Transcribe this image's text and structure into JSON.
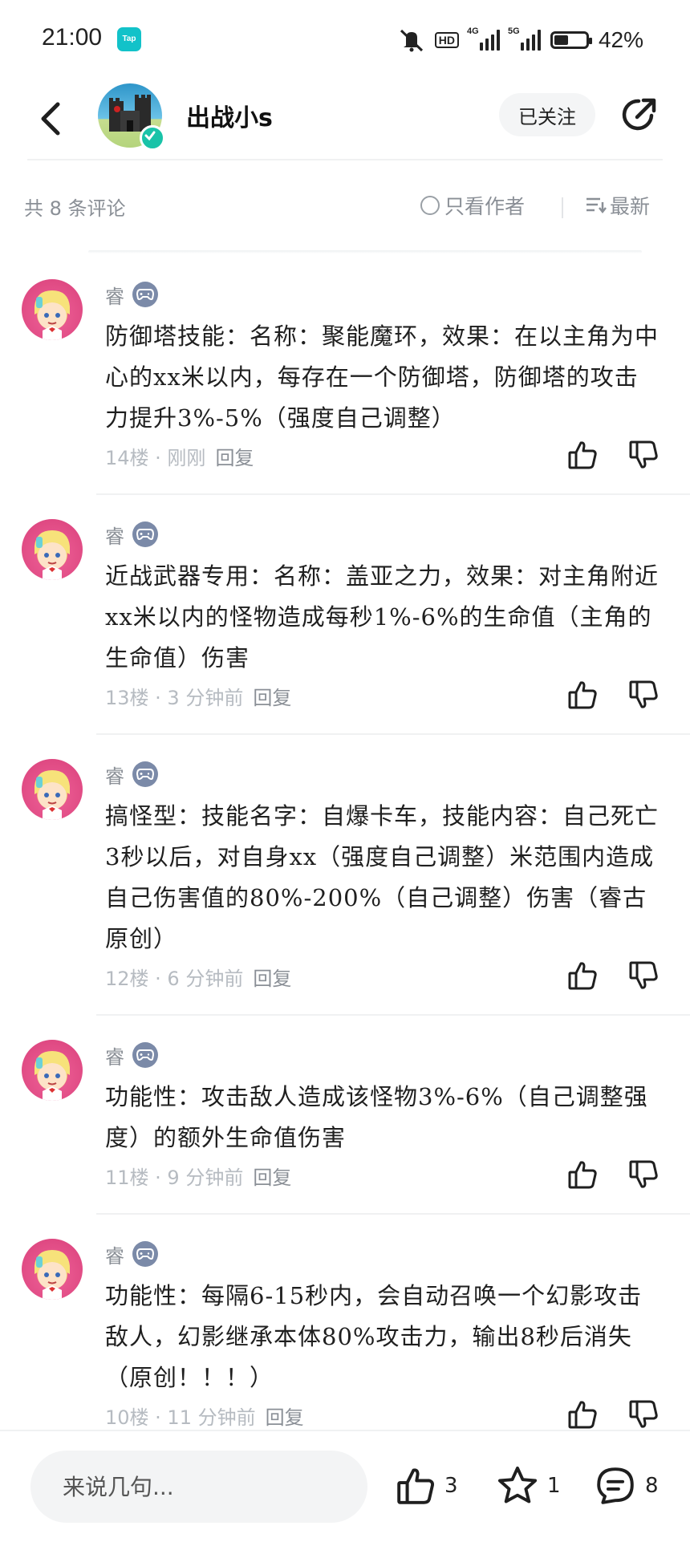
{
  "status_bar": {
    "time": "21:00",
    "app_icon_label": "Tap",
    "hd_label": "HD",
    "network1": "4G",
    "network2": "5G",
    "battery": "42%",
    "battery_level": 0.42
  },
  "header": {
    "title": "出战小s",
    "follow_label": "已关注"
  },
  "sort_bar": {
    "count_text": "共 8 条评论",
    "only_author": "只看作者",
    "sort_label": "最新"
  },
  "comments": [
    {
      "user": "睿",
      "text": "防御塔技能：名称：聚能魔环，效果：在以主角为中心的xx米以内，每存在一个防御塔，防御塔的攻击力提升3%-5%（强度自己调整）",
      "floor_time": "14楼 · 刚刚",
      "reply": "回复"
    },
    {
      "user": "睿",
      "text": "近战武器专用：名称：盖亚之力，效果：对主角附近xx米以内的怪物造成每秒1%-6%的生命值（主角的生命值）伤害",
      "floor_time": "13楼 · 3 分钟前",
      "reply": "回复"
    },
    {
      "user": "睿",
      "text": "搞怪型：技能名字：自爆卡车，技能内容：自己死亡3秒以后，对自身xx（强度自己调整）米范围内造成自己伤害值的80%-200%（自己调整）伤害（睿古原创）",
      "floor_time": "12楼 · 6 分钟前",
      "reply": "回复"
    },
    {
      "user": "睿",
      "text": "功能性：攻击敌人造成该怪物3%-6%（自己调整强度）的额外生命值伤害",
      "floor_time": "11楼 · 9 分钟前",
      "reply": "回复"
    },
    {
      "user": "睿",
      "text": "功能性：每隔6-15秒内，会自动召唤一个幻影攻击敌人，幻影继承本体80%攻击力，输出8秒后消失（原创！！！）",
      "floor_time": "10楼 · 11 分钟前",
      "reply": "回复"
    }
  ],
  "bottom_bar": {
    "placeholder": "来说几句...",
    "like_count": "3",
    "star_count": "1",
    "comment_count": "8"
  },
  "icons": {
    "back": "back-arrow-icon",
    "share": "share-icon",
    "like": "thumb-up-icon",
    "dislike": "thumb-down-icon",
    "star": "star-icon",
    "comment": "comment-icon",
    "badge": "gamepad-icon"
  }
}
